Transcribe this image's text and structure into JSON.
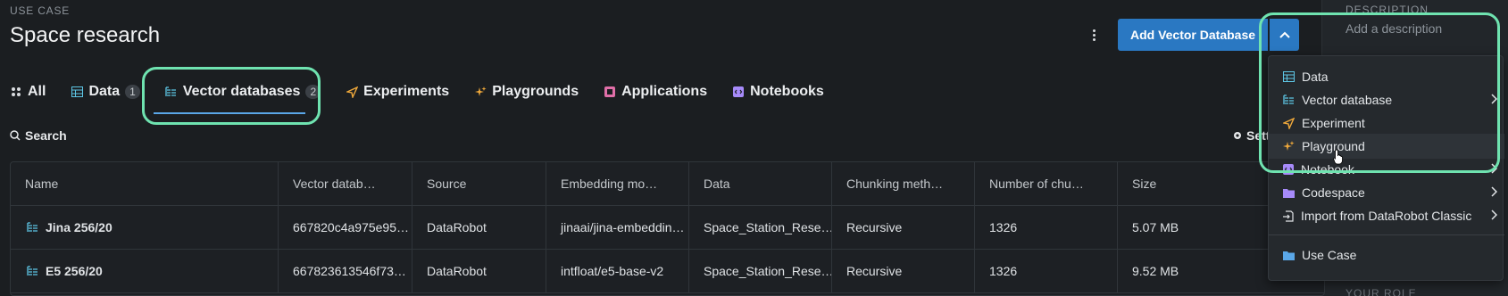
{
  "header": {
    "section_label": "USE CASE",
    "title": "Space research",
    "add_button_label": "Add Vector Database"
  },
  "right_panel": {
    "description_label": "DESCRIPTION",
    "description_placeholder": "Add a description",
    "role_label": "YOUR ROLE"
  },
  "tabs": [
    {
      "label": "All",
      "icon": "grid-icon"
    },
    {
      "label": "Data",
      "count": "1",
      "icon": "table-icon"
    },
    {
      "label": "Vector databases",
      "count": "2",
      "icon": "vector-db-icon",
      "active": true
    },
    {
      "label": "Experiments",
      "icon": "experiment-icon"
    },
    {
      "label": "Playgrounds",
      "icon": "sparkle-icon"
    },
    {
      "label": "Applications",
      "icon": "app-icon"
    },
    {
      "label": "Notebooks",
      "icon": "notebook-icon"
    }
  ],
  "toolbar": {
    "search_label": "Search",
    "settings_label": "Sett"
  },
  "table": {
    "columns": [
      "Name",
      "Vector datab…",
      "Source",
      "Embedding mo…",
      "Data",
      "Chunking meth…",
      "Number of chu…",
      "Size"
    ],
    "rows": [
      [
        "Jina 256/20",
        "667820c4a975e95…",
        "DataRobot",
        "jinaai/jina-embeddin…",
        "Space_Station_Rese…",
        "Recursive",
        "1326",
        "5.07 MB"
      ],
      [
        "E5 256/20",
        "667823613546f73…",
        "DataRobot",
        "intfloat/e5-base-v2",
        "Space_Station_Rese…",
        "Recursive",
        "1326",
        "9.52 MB"
      ]
    ]
  },
  "dropdown": {
    "items": [
      {
        "label": "Data",
        "icon": "table-icon",
        "submenu": false
      },
      {
        "label": "Vector database",
        "icon": "vector-db-icon",
        "submenu": true
      },
      {
        "label": "Experiment",
        "icon": "experiment-icon",
        "submenu": false
      },
      {
        "label": "Playground",
        "icon": "sparkle-icon",
        "submenu": false,
        "hovered": true
      },
      {
        "label": "Notebook",
        "icon": "notebook-icon",
        "submenu": true
      },
      {
        "label": "Codespace",
        "icon": "folder-icon",
        "submenu": true
      },
      {
        "label": "Import from DataRobot Classic",
        "icon": "import-icon",
        "submenu": true
      },
      {
        "label": "Use Case",
        "icon": "folder-icon",
        "submenu": false
      }
    ]
  },
  "colors": {
    "accent": "#2a78c2",
    "highlight": "#6fe3b0",
    "active_tab_line": "#5aa7e8",
    "experiment_icon": "#f0a93b",
    "notebook_icon": "#a78bfa",
    "data_icon": "#5ec7e6"
  }
}
